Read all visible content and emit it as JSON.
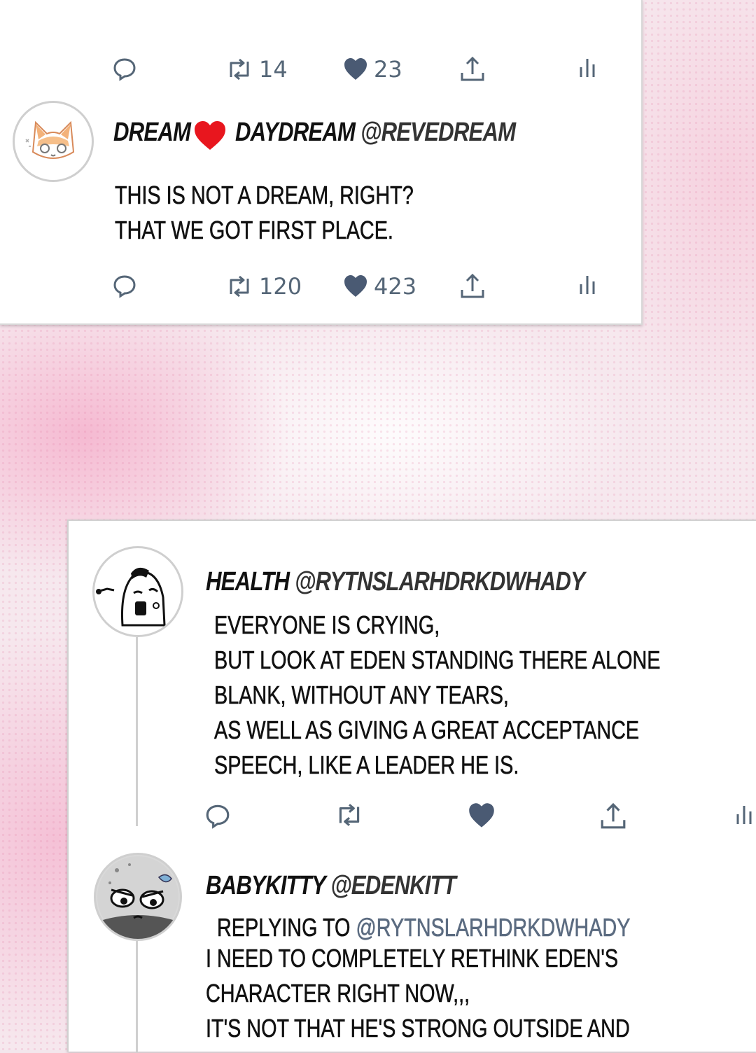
{
  "top_actions": {
    "retweets": "14",
    "likes": "23"
  },
  "tweet1": {
    "name_left": "DREAM",
    "name_right": "DAYDREAM",
    "handle": "@REVEDREAM",
    "lines": [
      "THIS IS NOT A DREAM, RIGHT?",
      "THAT WE GOT FIRST PLACE."
    ],
    "retweets": "120",
    "likes": "423"
  },
  "tweet2": {
    "name": "HEALTH",
    "handle": "@RYTNSLARHDRKDWHADY",
    "lines": [
      "EVERYONE IS CRYING,",
      "BUT LOOK AT EDEN STANDING THERE ALONE",
      "BLANK, WITHOUT ANY TEARS,",
      "AS WELL AS GIVING A GREAT ACCEPTANCE",
      "SPEECH, LIKE A LEADER HE IS."
    ]
  },
  "tweet3": {
    "name": "BABYKITTY",
    "handle": "@EDENKITT",
    "replying_prefix": "REPLYING TO",
    "replying_handle": "@RYTNSLARHDRKDWHADY",
    "lines": [
      "I NEED TO COMPLETELY RETHINK EDEN'S",
      "CHARACTER RIGHT NOW,,,",
      "IT'S NOT THAT HE'S STRONG OUTSIDE AND"
    ]
  },
  "colors": {
    "icon": "#556677",
    "heart_red": "#e8161e",
    "like_heart": "#4a5a73",
    "reply_handle": "#5b6b80"
  }
}
